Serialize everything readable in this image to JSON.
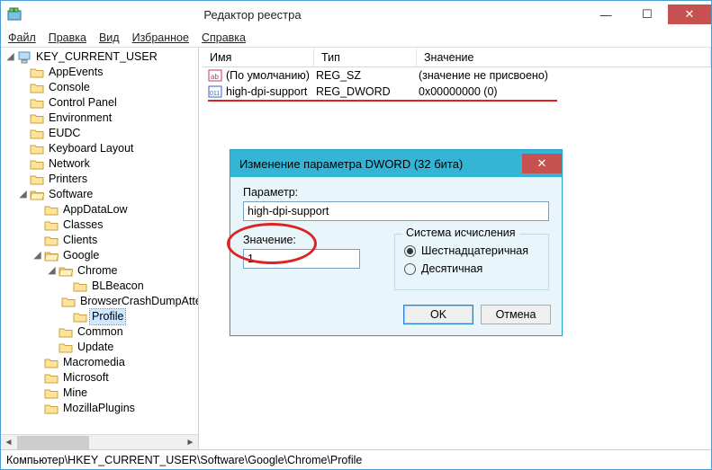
{
  "window": {
    "title": "Редактор реестра"
  },
  "menu": {
    "file": "Файл",
    "edit": "Правка",
    "view": "Вид",
    "favorites": "Избранное",
    "help": "Справка"
  },
  "tree": {
    "root": "KEY_CURRENT_USER",
    "items": [
      {
        "label": "AppEvents"
      },
      {
        "label": "Console"
      },
      {
        "label": "Control Panel"
      },
      {
        "label": "Environment"
      },
      {
        "label": "EUDC"
      },
      {
        "label": "Keyboard Layout"
      },
      {
        "label": "Network"
      },
      {
        "label": "Printers"
      },
      {
        "label": "Software",
        "expanded": true,
        "children": [
          {
            "label": "AppDataLow"
          },
          {
            "label": "Classes"
          },
          {
            "label": "Clients"
          },
          {
            "label": "Google",
            "expanded": true,
            "children": [
              {
                "label": "Chrome",
                "expanded": true,
                "children": [
                  {
                    "label": "BLBeacon"
                  },
                  {
                    "label": "BrowserCrashDumpAttempts"
                  },
                  {
                    "label": "Profile",
                    "selected": true
                  }
                ]
              },
              {
                "label": "Common"
              },
              {
                "label": "Update"
              }
            ]
          },
          {
            "label": "Macromedia"
          },
          {
            "label": "Microsoft"
          },
          {
            "label": "Mine"
          },
          {
            "label": "MozillaPlugins"
          }
        ]
      }
    ]
  },
  "cols": {
    "name": "Имя",
    "type": "Тип",
    "value": "Значение"
  },
  "values": [
    {
      "kind": "sz",
      "name": "(По умолчанию)",
      "type": "REG_SZ",
      "value": "(значение не присвоено)"
    },
    {
      "kind": "dw",
      "name": "high-dpi-support",
      "type": "REG_DWORD",
      "value": "0x00000000 (0)"
    }
  ],
  "dialog": {
    "title": "Изменение параметра DWORD (32 бита)",
    "param_label": "Параметр:",
    "param_value": "high-dpi-support",
    "value_label": "Значение:",
    "value_value": "1",
    "base_label": "Система исчисления",
    "hex": "Шестнадцатеричная",
    "dec": "Десятичная",
    "ok": "OK",
    "cancel": "Отмена"
  },
  "status": "Компьютер\\HKEY_CURRENT_USER\\Software\\Google\\Chrome\\Profile"
}
